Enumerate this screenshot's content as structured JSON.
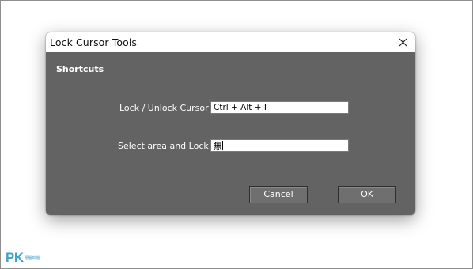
{
  "window": {
    "title": "Lock Cursor Tools",
    "close_icon": "close-icon"
  },
  "section_heading": "Shortcuts",
  "shortcuts": [
    {
      "label": "Lock / Unlock Cursor",
      "value": "Ctrl + Alt + I"
    },
    {
      "label": "Select area and Lock",
      "value": "無"
    }
  ],
  "buttons": {
    "cancel": "Cancel",
    "ok": "OK"
  },
  "watermark": {
    "logo": "PK",
    "sub": "電腦軟體"
  },
  "colors": {
    "dialog_body": "#636363",
    "titlebar": "#ffffff",
    "accent_watermark": "#3fa3c9"
  }
}
